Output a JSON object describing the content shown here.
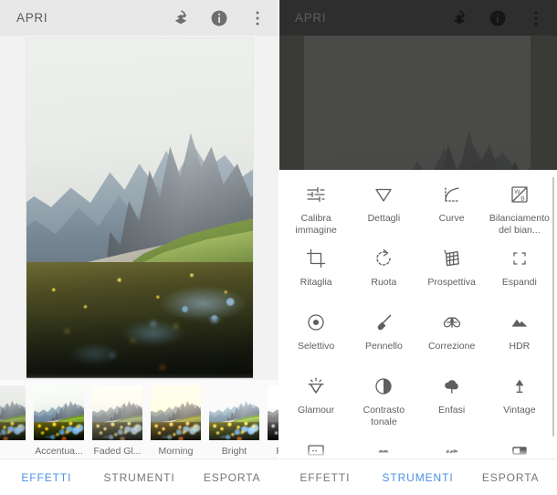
{
  "app": {
    "title": "APRI",
    "accent_color": "#4a90e2",
    "appbar_light_bg": "#e8e8e8",
    "appbar_dark_bg": "#2e2e2e"
  },
  "appbar_icons": [
    {
      "name": "undo-stack-icon",
      "label": "Annulla"
    },
    {
      "name": "info-icon",
      "label": "Informazioni"
    },
    {
      "name": "overflow-menu-icon",
      "label": "Altro"
    }
  ],
  "left_panel": {
    "appbar_title": "APRI",
    "photo_alt": "Paesaggio di montagna con fiori",
    "filters": [
      {
        "label": "",
        "style": "fx-orig",
        "partial": true
      },
      {
        "label": "Accentua...",
        "style": "fx-accent",
        "partial": false
      },
      {
        "label": "Faded Gl...",
        "style": "fx-faded",
        "partial": false
      },
      {
        "label": "Morning",
        "style": "fx-morning",
        "partial": false
      },
      {
        "label": "Bright",
        "style": "fx-bright",
        "partial": false
      },
      {
        "label": "Fine Art",
        "style": "fx-fineart",
        "partial": false
      },
      {
        "label": "",
        "style": "fx-bw2",
        "partial": true
      }
    ],
    "tabs": [
      {
        "label": "EFFETTI",
        "active": true
      },
      {
        "label": "STRUMENTI",
        "active": false
      },
      {
        "label": "ESPORTA",
        "active": false
      }
    ]
  },
  "right_panel": {
    "appbar_title": "APRI",
    "tools": [
      {
        "label": "Calibra immagine",
        "icon": "tune-sliders-icon"
      },
      {
        "label": "Dettagli",
        "icon": "triangle-down-icon"
      },
      {
        "label": "Curve",
        "icon": "curves-icon"
      },
      {
        "label": "Bilanciamento del bian...",
        "icon": "white-balance-icon"
      },
      {
        "label": "Ritaglia",
        "icon": "crop-icon"
      },
      {
        "label": "Ruota",
        "icon": "rotate-icon"
      },
      {
        "label": "Prospettiva",
        "icon": "perspective-icon"
      },
      {
        "label": "Espandi",
        "icon": "expand-icon"
      },
      {
        "label": "Selettivo",
        "icon": "selective-target-icon"
      },
      {
        "label": "Pennello",
        "icon": "brush-icon"
      },
      {
        "label": "Correzione",
        "icon": "healing-patch-icon"
      },
      {
        "label": "HDR",
        "icon": "hdr-mountain-icon"
      },
      {
        "label": "Glamour",
        "icon": "glamour-gem-icon"
      },
      {
        "label": "Contrasto tonale",
        "icon": "tonal-contrast-icon"
      },
      {
        "label": "Enfasi",
        "icon": "drama-cloud-icon"
      },
      {
        "label": "Vintage",
        "icon": "vintage-lamp-icon"
      },
      {
        "label": "",
        "icon": "frames-icon"
      },
      {
        "label": "",
        "icon": "grain-icon"
      },
      {
        "label": "",
        "icon": "grunge-icon"
      },
      {
        "label": "",
        "icon": "double-exposure-icon"
      }
    ],
    "tabs": [
      {
        "label": "EFFETTI",
        "active": false
      },
      {
        "label": "STRUMENTI",
        "active": true
      },
      {
        "label": "ESPORTA",
        "active": false
      }
    ]
  }
}
